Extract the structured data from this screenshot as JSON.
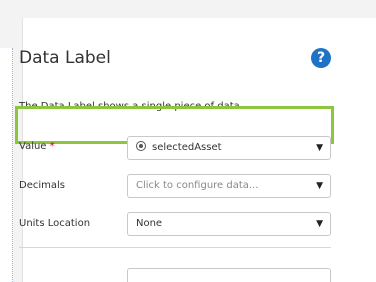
{
  "panel": {
    "title": "Data Label",
    "description": "The Data Label shows a single piece of data.",
    "help_icon": "question-circle-icon"
  },
  "fields": {
    "value": {
      "label": "Value",
      "required_mark": "*",
      "selected": "selectedAsset",
      "icon": "radio-target-icon"
    },
    "decimals": {
      "label": "Decimals",
      "placeholder": "Click to configure data..."
    },
    "units_location": {
      "label": "Units Location",
      "selected": "None"
    }
  },
  "colors": {
    "highlight": "#8cc63f",
    "help_icon": "#1f73c7",
    "required": "#d0021b"
  }
}
